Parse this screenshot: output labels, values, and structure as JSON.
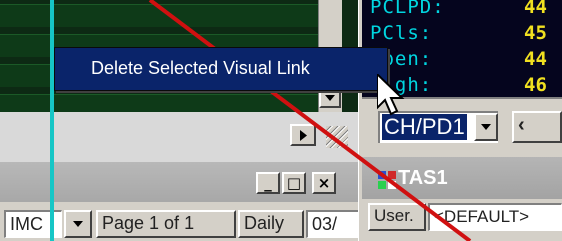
{
  "context_menu": {
    "items": [
      {
        "label": "Delete Selected Visual Link",
        "highlighted": true
      }
    ]
  },
  "quote_panel": {
    "rows": [
      {
        "label": "PCLPD:",
        "value": "44"
      },
      {
        "label": "PCls:",
        "value": "45"
      },
      {
        "label": "Open:",
        "value": "44"
      },
      {
        "label": "High:",
        "value": "46"
      }
    ]
  },
  "symbol_combo": {
    "value": "CH/PD1"
  },
  "chart_window": {
    "controls": {
      "minimize": "_",
      "maximize": "□",
      "close": "×"
    },
    "toolbar": {
      "instrument_value": "IMC",
      "page_label": "Page 1 of 1",
      "period": "Daily",
      "date_value": "03/"
    }
  },
  "tas_window": {
    "title": "TAS1",
    "toolbar": {
      "user_label": "User.",
      "layout_value": "<DEFAULT>"
    }
  },
  "colors": {
    "chart_background": "#0d2a14",
    "quote_background": "#05051e",
    "quote_label": "#00d6e0",
    "quote_value": "#f0e020",
    "menu_highlight": "#0a246a",
    "link_line": "#d01010",
    "cyan_line": "#16c6c6"
  }
}
